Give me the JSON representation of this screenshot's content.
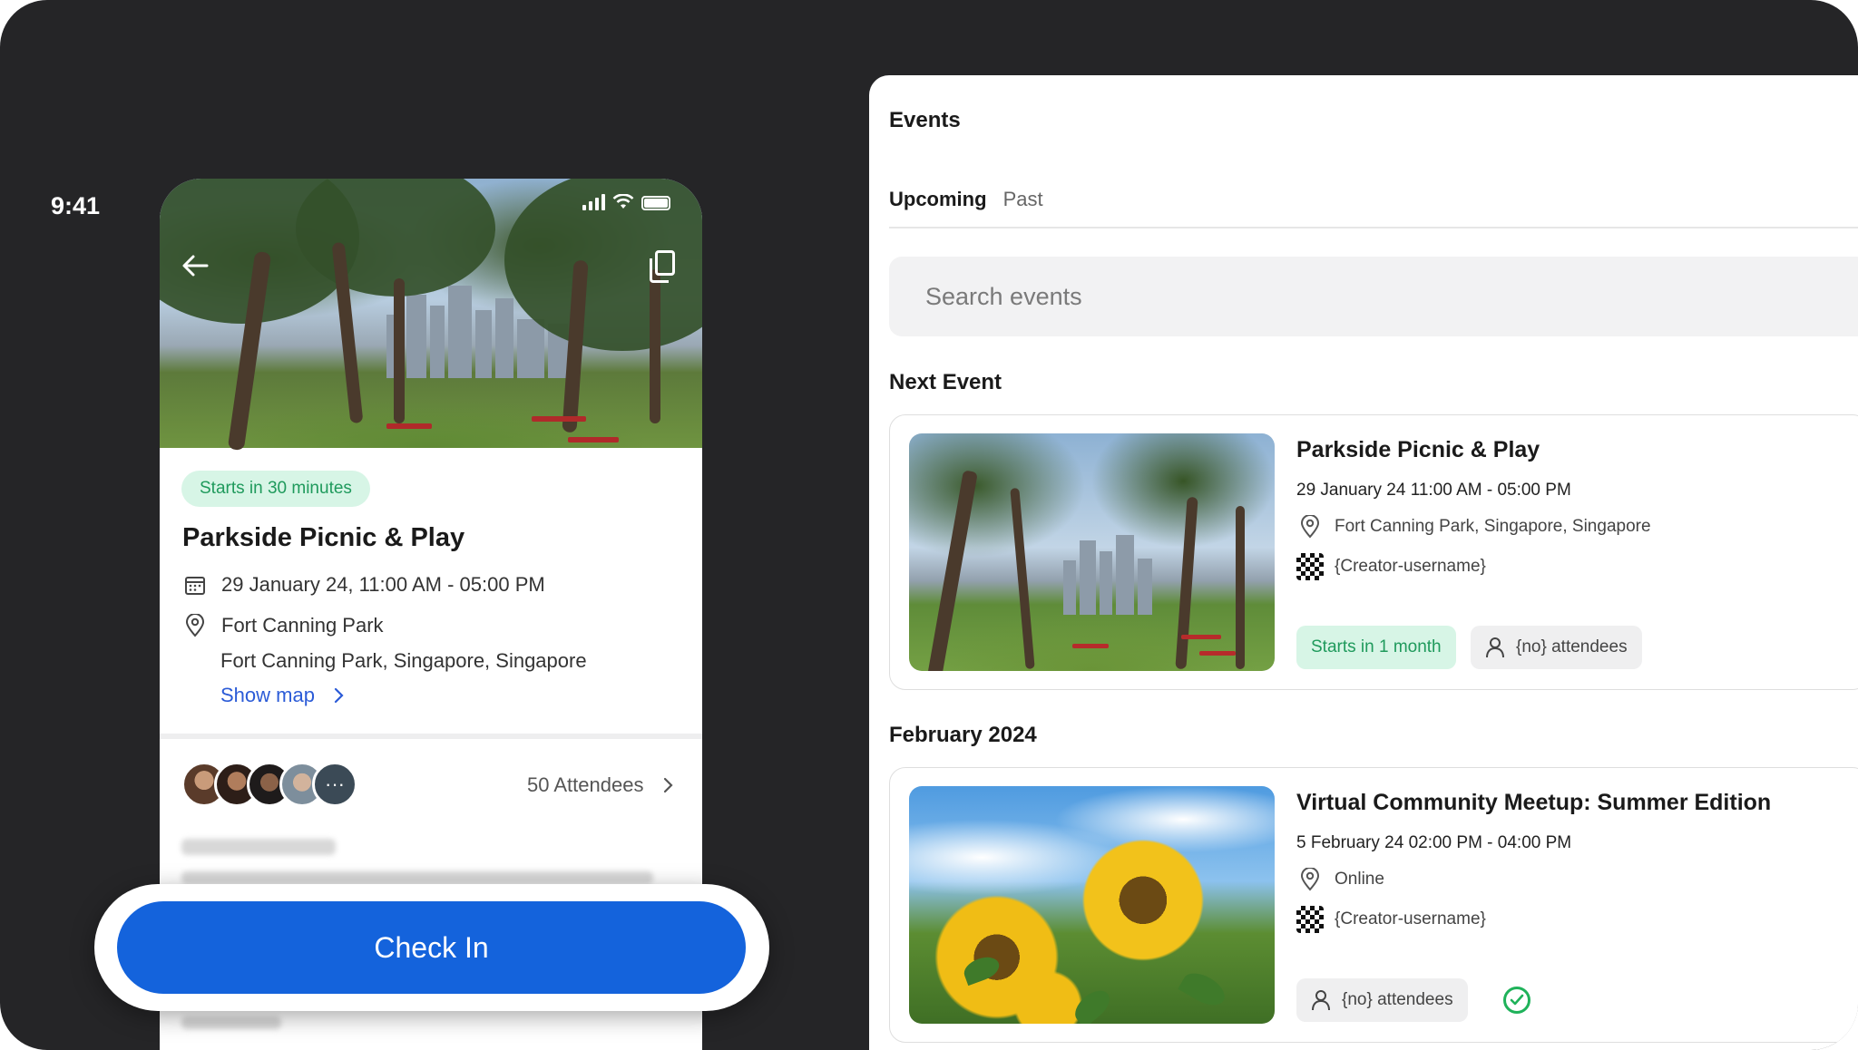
{
  "phone": {
    "status_time": "9:41",
    "badge": "Starts in 30 minutes",
    "title": "Parkside Picnic & Play",
    "datetime": "29 January 24, 11:00 AM - 05:00 PM",
    "venue": "Fort Canning Park",
    "address": "Fort Canning Park, Singapore, Singapore",
    "show_map": "Show map",
    "attendees": "50 Attendees",
    "cta": "Check In",
    "icons": [
      "back-arrow-icon",
      "copy-icon",
      "calendar-icon",
      "location-pin-icon",
      "chevron-right-icon"
    ]
  },
  "events": {
    "title": "Events",
    "tabs": [
      {
        "label": "Upcoming",
        "active": true
      },
      {
        "label": "Past",
        "active": false
      }
    ],
    "search_placeholder": "Search events",
    "next_event_heading": "Next Event",
    "next_event": {
      "title": "Parkside Picnic & Play",
      "datetime": "29 January 24 11:00 AM - 05:00 PM",
      "location": "Fort Canning Park, Singapore, Singapore",
      "creator": "{Creator-username}",
      "starts": "Starts in 1 month",
      "attendees": "{no} attendees"
    },
    "month_heading": "February 2024",
    "month_events": [
      {
        "title": "Virtual Community Meetup: Summer Edition",
        "datetime": "5 February 24 02:00 PM - 04:00 PM",
        "location": "Online",
        "creator": "{Creator-username}",
        "attendees": "{no} attendees",
        "checked_in": true
      }
    ]
  },
  "colors": {
    "background": "#252527",
    "accent_blue": "#1463dc",
    "badge_green_bg": "#d7f5e6",
    "badge_green_text": "#1f9a5c",
    "link_blue": "#2b5bd7"
  }
}
